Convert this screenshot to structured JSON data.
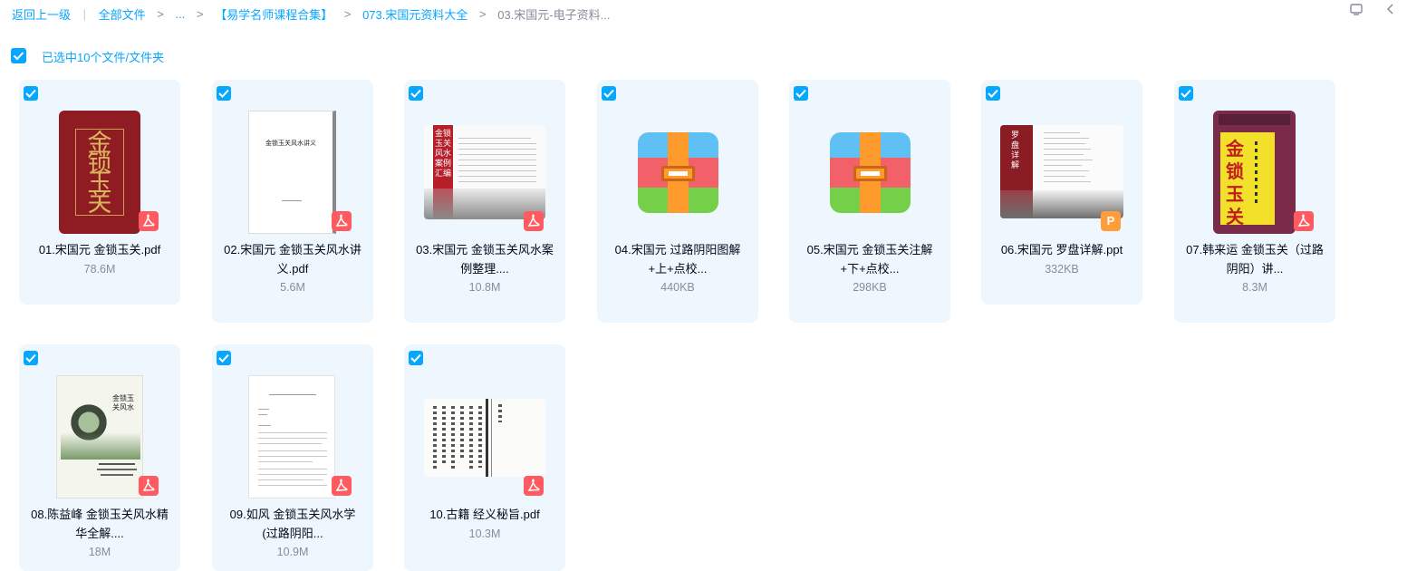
{
  "breadcrumb": {
    "back": "返回上一级",
    "all_files": "全部文件",
    "ellipsis": "...",
    "level1": "【易学名师课程合集】",
    "level2": "073.宋国元资料大全",
    "current": "03.宋国元-电子资料..."
  },
  "selection": {
    "label": "已选中10个文件/文件夹",
    "checked": true
  },
  "colors": {
    "accent": "#06a7ff",
    "card_bg": "#eef7fe",
    "pdf_red": "#ff5a5f",
    "ppt_orange": "#ff9d3a"
  },
  "files": [
    {
      "name_line1": "01.宋国元 金锁玉关.pdf",
      "name_line2": "",
      "size": "78.6M",
      "type": "pdf",
      "checked": true,
      "cover_text": "金锁玉关"
    },
    {
      "name_line1": "02.宋国元 金锁玉关风水讲",
      "name_line2": "义.pdf",
      "size": "5.6M",
      "type": "pdf",
      "checked": true,
      "cover_text": "金锁玉关风水讲义"
    },
    {
      "name_line1": "03.宋国元 金锁玉关风水案",
      "name_line2": "例整理....",
      "size": "10.8M",
      "type": "pdf",
      "checked": true,
      "cover_text": "金锁玉关风水案例汇编"
    },
    {
      "name_line1": "04.宋国元 过路阴阳图解",
      "name_line2": "+上+点校...",
      "size": "440KB",
      "type": "zip",
      "checked": true
    },
    {
      "name_line1": "05.宋国元 金锁玉关注解",
      "name_line2": "+下+点校...",
      "size": "298KB",
      "type": "zip",
      "checked": true
    },
    {
      "name_line1": "06.宋国元 罗盘详解.ppt",
      "name_line2": "",
      "size": "332KB",
      "type": "ppt",
      "checked": true,
      "cover_text": "罗盘详解",
      "badge": "P"
    },
    {
      "name_line1": "07.韩来运 金锁玉关（过路",
      "name_line2": "阴阳）讲...",
      "size": "8.3M",
      "type": "pdf",
      "checked": true,
      "cover_text": "金锁玉关"
    },
    {
      "name_line1": "08.陈益峰 金锁玉关风水精",
      "name_line2": "华全解....",
      "size": "18M",
      "type": "pdf",
      "checked": true,
      "cover_text": "金锁玉关风水"
    },
    {
      "name_line1": "09.如风 金锁玉关风水学",
      "name_line2": "(过路阴阳...",
      "size": "10.9M",
      "type": "pdf",
      "checked": true
    },
    {
      "name_line1": "10.古籍 经义秘旨.pdf",
      "name_line2": "",
      "size": "10.3M",
      "type": "pdf",
      "checked": true
    }
  ]
}
